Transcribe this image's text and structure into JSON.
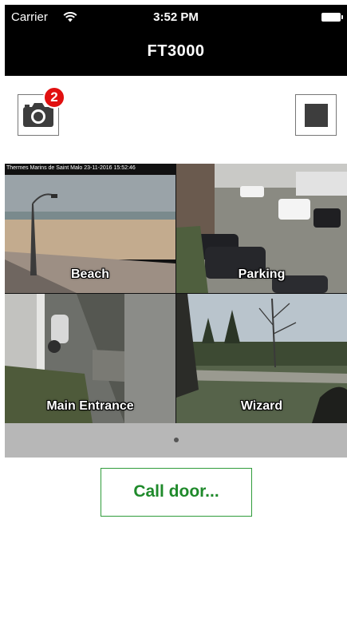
{
  "status_bar": {
    "carrier": "Carrier",
    "time": "3:52 PM"
  },
  "nav": {
    "title": "FT3000"
  },
  "toolbar": {
    "snapshot_badge": "2",
    "snapshot_icon": "camera-icon",
    "stop_icon": "stop-icon"
  },
  "cameras": [
    {
      "label": "Beach",
      "overlay": "Thermes Marins de Saint Malo 23-11-2016 15:52:46"
    },
    {
      "label": "Parking"
    },
    {
      "label": "Main Entrance"
    },
    {
      "label": "Wizard"
    }
  ],
  "pager": {
    "pages": 1,
    "current": 1
  },
  "actions": {
    "call_door": "Call door..."
  },
  "colors": {
    "nav_bg": "#000000",
    "badge": "#e11010",
    "call_border": "#2f9c3a",
    "call_text": "#1f8a2b",
    "pager_bg": "#b7b7b7"
  }
}
